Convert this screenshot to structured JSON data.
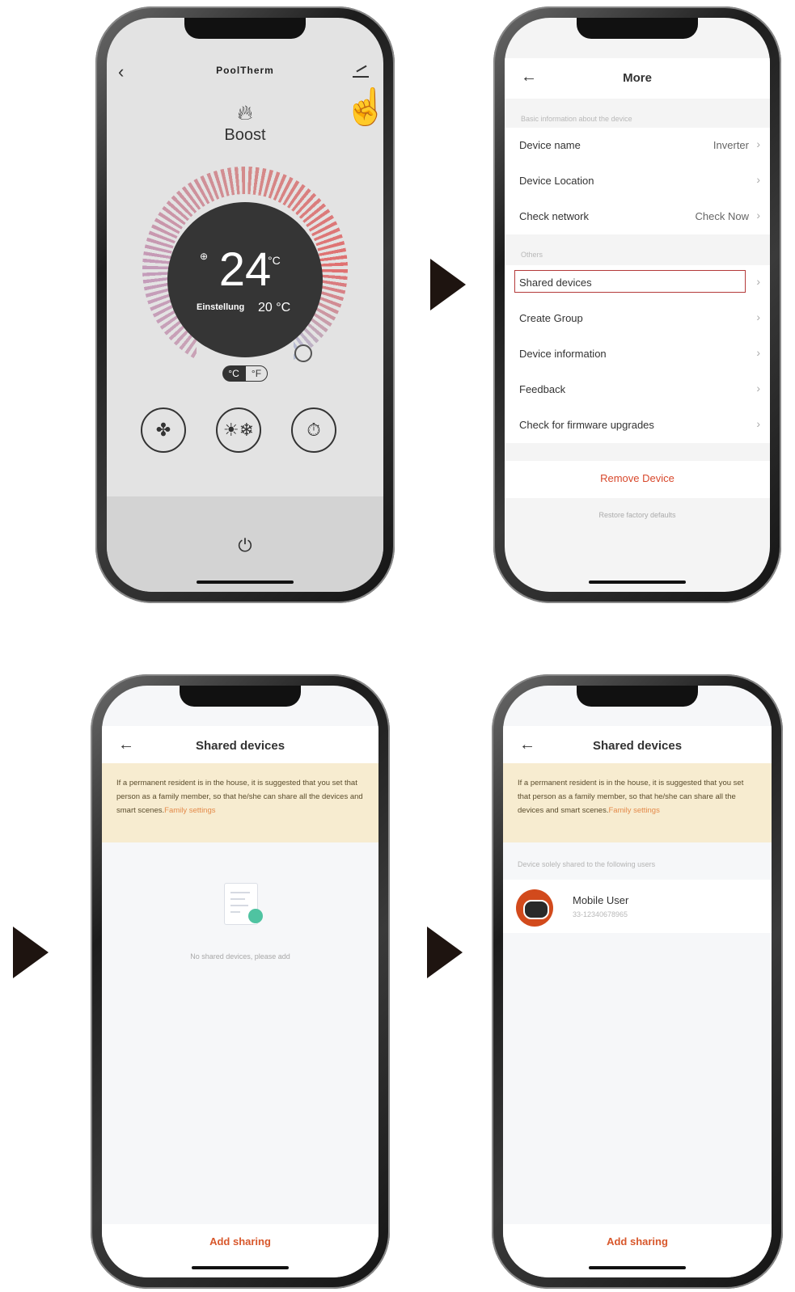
{
  "screen1": {
    "title": "PoolTherm",
    "mode": "Boost",
    "temp": "24",
    "temp_unit": "°C",
    "set_label": "Einstellung",
    "set_value": "20 °C",
    "unit_c": "°C",
    "unit_f": "°F"
  },
  "screen2": {
    "title": "More",
    "section_basic": "Basic information about the device",
    "rows_basic": [
      {
        "label": "Device name",
        "value": "Inverter"
      },
      {
        "label": "Device Location",
        "value": ""
      },
      {
        "label": "Check network",
        "value": "Check Now"
      }
    ],
    "section_others": "Others",
    "rows_others": [
      {
        "label": "Shared devices"
      },
      {
        "label": "Create Group"
      },
      {
        "label": "Device information"
      },
      {
        "label": "Feedback"
      },
      {
        "label": "Check for firmware upgrades"
      }
    ],
    "remove": "Remove Device",
    "restore": "Restore factory defaults"
  },
  "screen3": {
    "title": "Shared devices",
    "notice": "If a permanent resident is in the house, it is suggested that you set that person as a family member, so that he/she can share all the devices and smart scenes.",
    "notice_link": "Family settings",
    "empty": "No shared devices, please add",
    "add": "Add sharing"
  },
  "screen4": {
    "title": "Shared devices",
    "notice": "If a permanent resident is in the house, it is suggested that you set that person as a family member, so that he/she can share all the devices and smart scenes.",
    "notice_link": "Family settings",
    "shared_header": "Device solely shared to the following users",
    "user_name": "Mobile User",
    "user_id": "33-12340678965",
    "add": "Add sharing"
  },
  "colors": {
    "accent": "#d8582c",
    "highlight": "#b43a3a",
    "notice_bg": "#f7ecd0"
  }
}
